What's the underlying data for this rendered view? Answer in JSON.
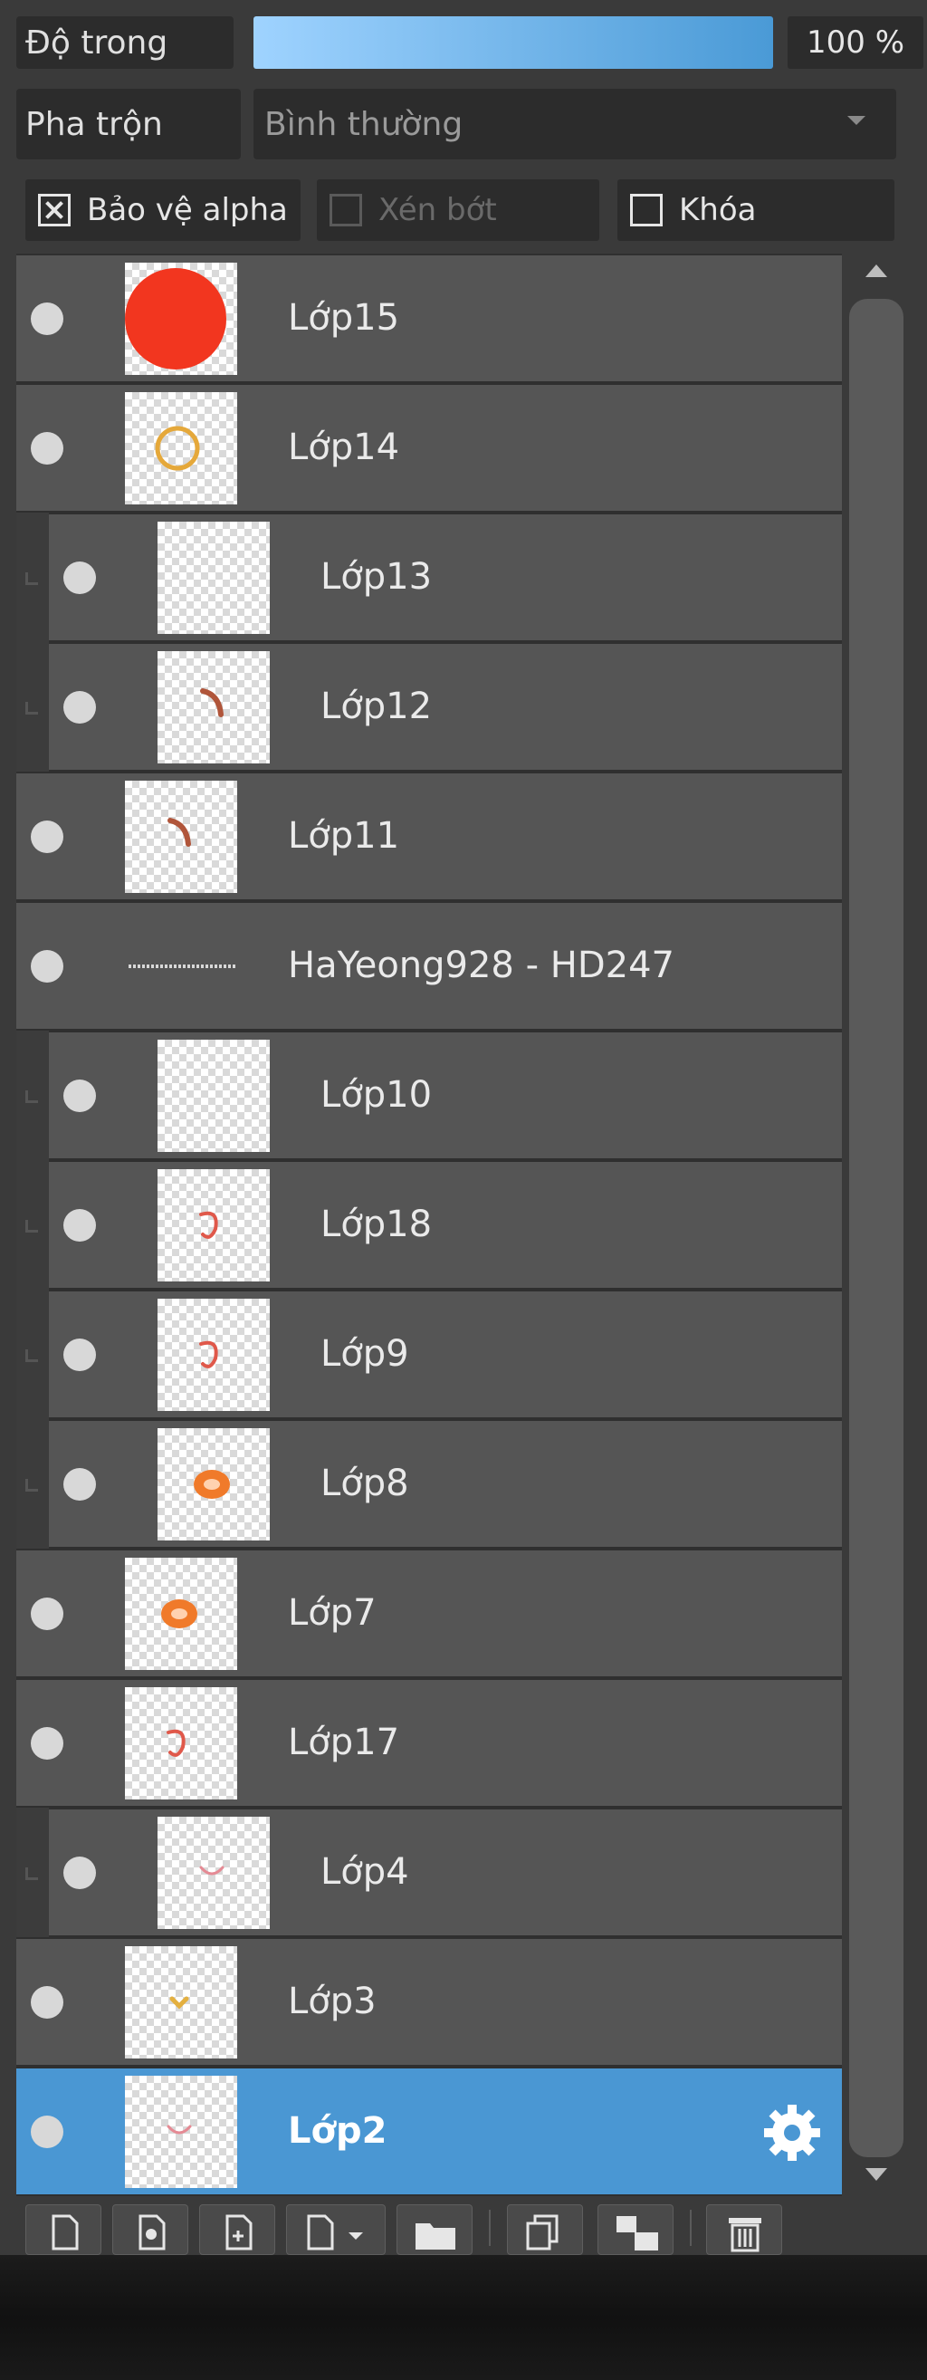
{
  "header": {
    "opacity_label": "Độ trong",
    "opacity_value": "100 %",
    "opacity_fraction": 1.0,
    "blend_label": "Pha trộn",
    "blend_value": "Bình thường",
    "protect_alpha": {
      "label": "Bảo vệ alpha",
      "checked": true
    },
    "clipping": {
      "label": "Xén bớt",
      "checked": false,
      "enabled": false
    },
    "lock": {
      "label": "Khóa",
      "checked": false
    }
  },
  "layers": [
    {
      "name": "Lớp15",
      "clipped": false,
      "selected": false,
      "thumb": "red-circle-icon"
    },
    {
      "name": "Lớp14",
      "clipped": false,
      "selected": false,
      "thumb": "yellow-ring-icon"
    },
    {
      "name": "Lớp13",
      "clipped": true,
      "selected": false,
      "thumb": "empty"
    },
    {
      "name": "Lớp12",
      "clipped": true,
      "selected": false,
      "thumb": "brown-stroke-icon"
    },
    {
      "name": "Lớp11",
      "clipped": false,
      "selected": false,
      "thumb": "brown-stroke-icon"
    },
    {
      "name": "HaYeong928 - HD247",
      "clipped": false,
      "selected": false,
      "thumb": "text-mark"
    },
    {
      "name": "Lớp10",
      "clipped": true,
      "selected": false,
      "thumb": "empty"
    },
    {
      "name": "Lớp18",
      "clipped": true,
      "selected": false,
      "thumb": "red-stroke-icon"
    },
    {
      "name": "Lớp9",
      "clipped": true,
      "selected": false,
      "thumb": "red-stroke-icon"
    },
    {
      "name": "Lớp8",
      "clipped": true,
      "selected": false,
      "thumb": "orange-blob-icon"
    },
    {
      "name": "Lớp7",
      "clipped": false,
      "selected": false,
      "thumb": "orange-blob-icon"
    },
    {
      "name": "Lớp17",
      "clipped": false,
      "selected": false,
      "thumb": "red-stroke-icon"
    },
    {
      "name": "Lớp4",
      "clipped": true,
      "selected": false,
      "thumb": "pink-stroke-icon"
    },
    {
      "name": "Lớp3",
      "clipped": false,
      "selected": false,
      "thumb": "yellow-dot-icon"
    },
    {
      "name": "Lớp2",
      "clipped": false,
      "selected": true,
      "thumb": "pink-stroke-icon"
    }
  ],
  "toolbar": {
    "icons": [
      "new-layer-icon",
      "new-halftone-layer-icon",
      "new-layer-alt-icon",
      "add-layer-dropdown-icon",
      "folder-icon",
      "duplicate-layer-icon",
      "merge-down-icon",
      "delete-layer-icon"
    ]
  },
  "colors": {
    "panel_bg": "#3a3a3a",
    "layer_bg": "#555555",
    "selected_bg": "#4a97d3",
    "opacity_fill": "#4a9ad6"
  }
}
